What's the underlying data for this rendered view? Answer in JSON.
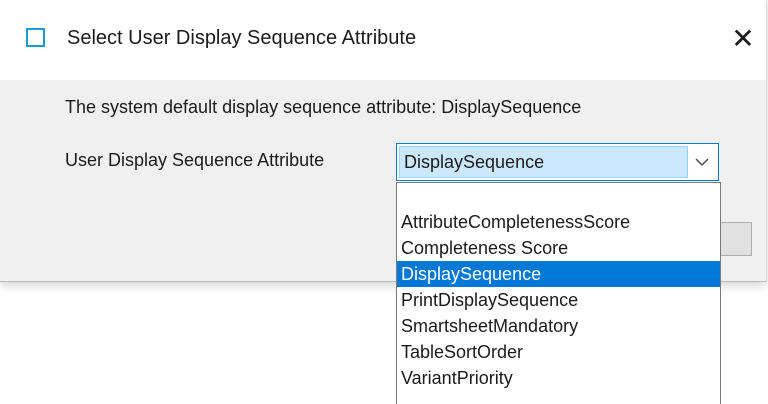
{
  "dialog": {
    "title": "Select User Display Sequence Attribute",
    "close_label": "✕",
    "description": "The system default display sequence attribute: DisplaySequence",
    "field_label": "User Display Sequence Attribute",
    "combo_value": "DisplaySequence"
  },
  "dropdown": {
    "items": [
      "AttributeCompletenessScore",
      "Completeness Score",
      "DisplaySequence",
      "PrintDisplaySequence",
      "SmartsheetMandatory",
      "TableSortOrder",
      "VariantPriority"
    ],
    "selected_index": 2
  },
  "colors": {
    "accent": "#0078d7",
    "selection_light": "#cce8ff",
    "icon": "#1a9ad6"
  },
  "icons": {
    "window": "window-icon",
    "close": "close-icon",
    "dropdown": "chevron-down-icon"
  }
}
